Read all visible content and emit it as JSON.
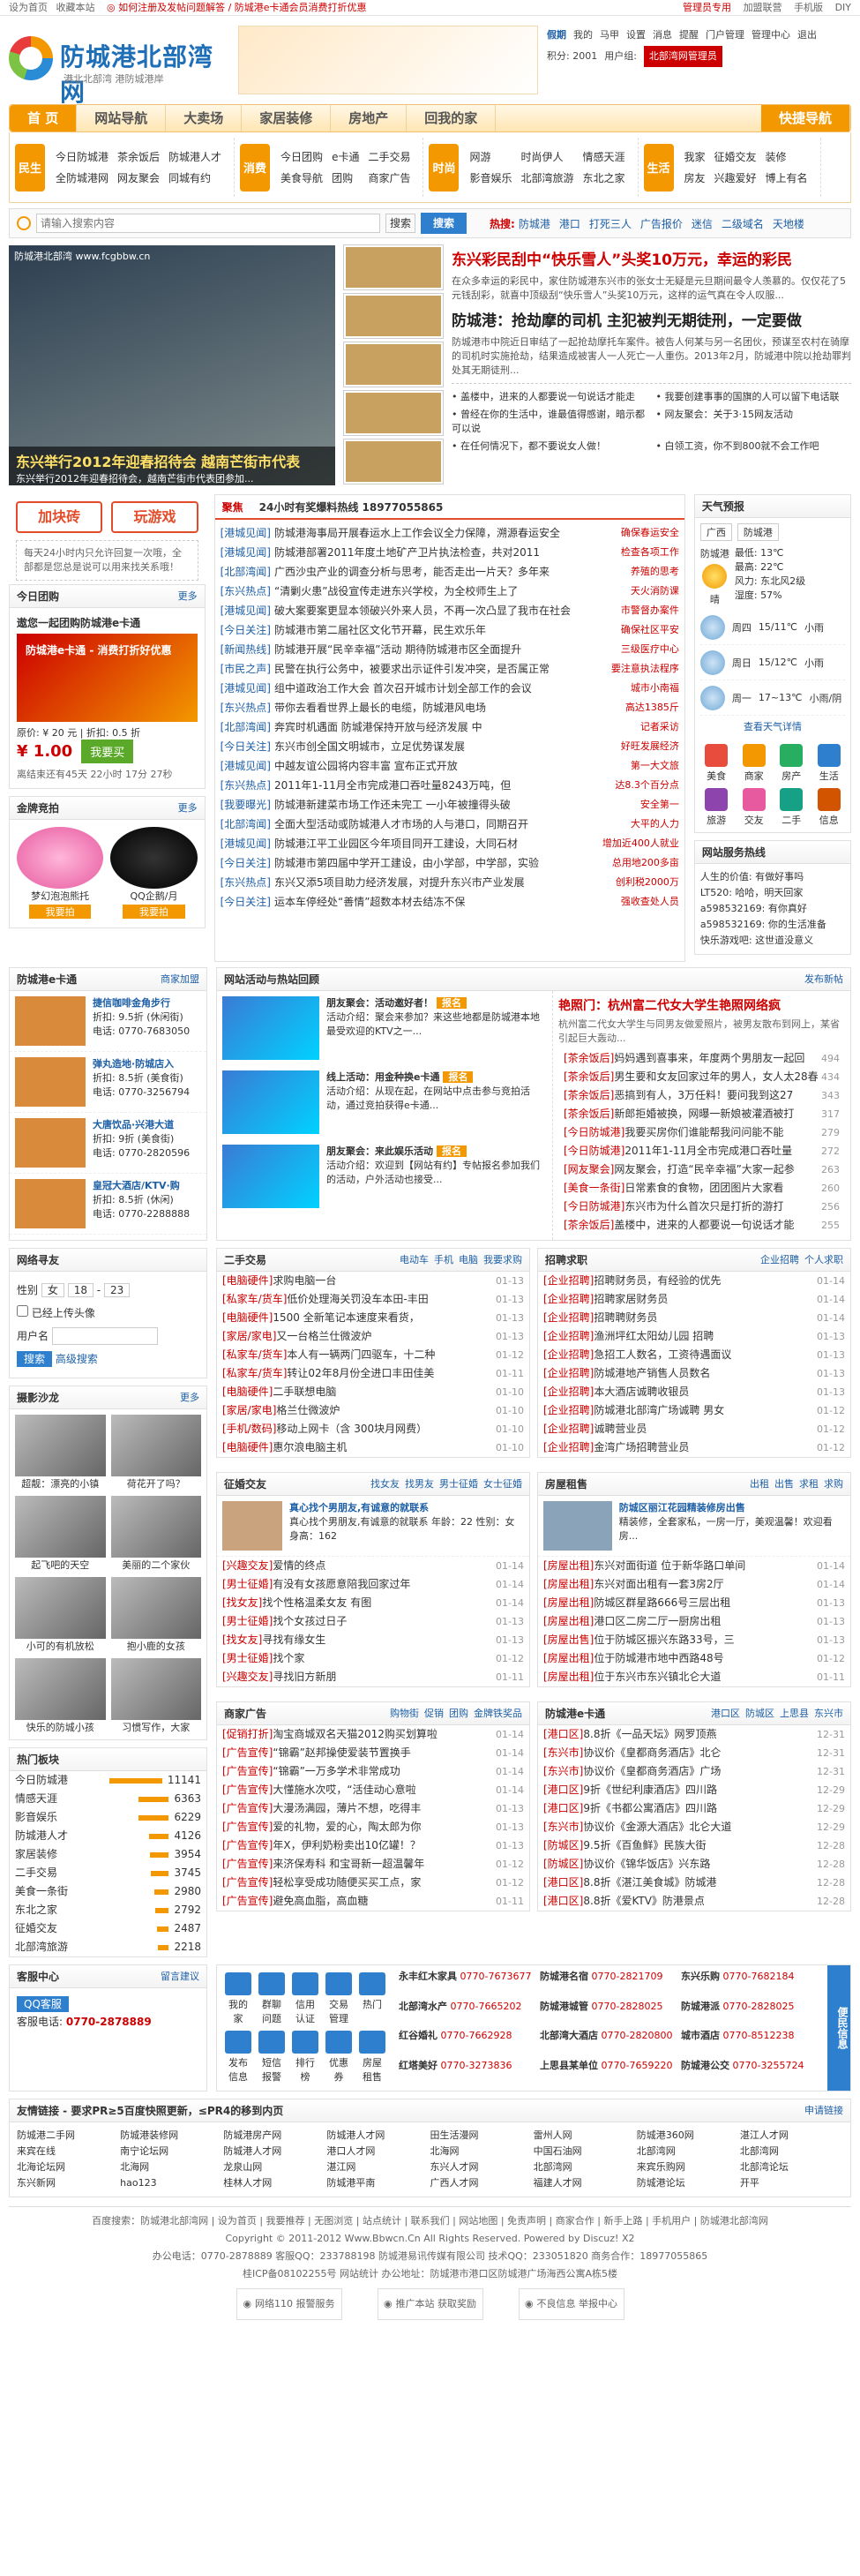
{
  "topbar": {
    "left": "设为首页",
    "fav": "收藏本站",
    "notice": "◎ 如何注册及发帖问题解答 / 防城港e卡通会员消费打折优惠",
    "right": [
      "管理员专用",
      "加盟联营",
      "手机版",
      "DIY"
    ]
  },
  "site": {
    "name": "防城港北部湾网",
    "slogan": "港北北部湾 港防城港岸"
  },
  "user": {
    "name": "假期",
    "links": [
      "我的",
      "马甲",
      "设置",
      "消息",
      "提醒",
      "门户管理",
      "管理中心",
      "退出"
    ],
    "points": "积分: 2001",
    "group": "用户组:",
    "group_val": "北部湾网管理员"
  },
  "nav": {
    "items": [
      "首 页",
      "网站导航",
      "大卖场",
      "家居装修",
      "房地产",
      "回我的家"
    ],
    "quick": "快捷导航"
  },
  "subnav": [
    {
      "title": "民生",
      "links": [
        "今日防城港",
        "茶余饭后",
        "防城港人才",
        "全防城港网",
        "网友聚会",
        "同城有约"
      ]
    },
    {
      "title": "消费",
      "links": [
        "今日团购",
        "e卡通",
        "二手交易",
        "美食导航",
        "团购",
        "商家广告"
      ]
    },
    {
      "title": "时尚",
      "links": [
        "网游",
        "时尚伊人",
        "情感天涯",
        "影音娱乐",
        "北部湾旅游",
        "东北之家"
      ]
    },
    {
      "title": "生活",
      "links": [
        "我家",
        "征婚交友",
        "装修",
        "房友",
        "兴趣爱好",
        "博上有名"
      ]
    }
  ],
  "search": {
    "placeholder": "请输入搜索内容",
    "scope": "搜索",
    "btn": "搜索",
    "hot_label": "热搜:",
    "hot": [
      "防城港",
      "港口",
      "打死三人",
      "广告报价",
      "迷信",
      "二级域名",
      "天地楼"
    ]
  },
  "slide": {
    "url": "防城港北部湾 www.fcgbbw.cn",
    "caption": "东兴举行2012年迎春招待会 越南芒街市代表",
    "sub": "东兴举行2012年迎春招待会，越南芒街市代表团参加..."
  },
  "headline": {
    "h1": "东兴彩民刮中“快乐雪人”头奖10万元，幸运的彩民",
    "p1": "在众多幸运的彩民中，家住防城港东兴市的张女士无疑是元旦期间最令人羡慕的。仅仅花了5元钱刮彩，就喜中顶级刮“快乐雪人”头奖10万元，这样的运气真在令人叹服...",
    "h2": "防城港：抢劫摩的司机 主犯被判无期徒刑，一定要做",
    "p2": "防城港市中院近日审结了一起抢劫摩托车案件。被告人何某与另一名团伙，预谋至农村在骑摩的司机时实施抢劫，结果造成被害人一人死亡一人重伤。2013年2月，防城港中院以抢劫罪判处其无期徒刑...",
    "list": [
      "盖楼中，进来的人都要说一句说话才能走",
      "我要创建事事的国旗的人可以留下电话联",
      "曾经在你的生活中，谁最值得感谢，暗示都可以说",
      "网友聚会：关于3·15网友活动",
      "在任何情况下，都不要说女人做！",
      "白领工资，你不到800就不会工作吧"
    ]
  },
  "left": {
    "btn1": "加块砖",
    "btn2": "玩游戏",
    "note": "每天24小时内只允许回复一次哦，全部都是您总是说可以用来找关系哦！",
    "today_title": "今日团购",
    "more": "更多",
    "group_title": "遨您一起团购防城港e卡通",
    "group_img": "防城港e卡通 - 消费打折好优惠",
    "orig": "原价: ¥ 20 元",
    "discount": "折扣: 0.5 折",
    "price": "¥ 1.00",
    "buy": "我要买",
    "deadline": "离结束还有45天 22小时 17分 27秒",
    "gold_title": "金牌竞拍",
    "auction": [
      {
        "name": "梦幻泡泡熊托",
        "btn": "我要拍"
      },
      {
        "name": "QQ企鹅/月",
        "btn": "我要拍"
      }
    ]
  },
  "mid": {
    "tabs": [
      "聚焦",
      "24小时有奖爆料热线 18977055865"
    ],
    "news": [
      {
        "cat": "[港城见闻]",
        "t": "防城港海事局开展春运水上工作会议全力保障，溯源春运安全",
        "s": "确保春运安全"
      },
      {
        "cat": "[港城见闻]",
        "t": "防城港部署2011年度土地矿产卫片执法检查，共对2011",
        "s": "检查各项工作"
      },
      {
        "cat": "[北部湾闻]",
        "t": "广西沙虫产业的调查分析与思考，能否走出一片天？多年来",
        "s": "养殖的思考"
      },
      {
        "cat": "[东兴热点]",
        "t": "“清剿火患”战役宣传走进东兴学校，为全校师生上了",
        "s": "天火消防课"
      },
      {
        "cat": "[港城见闻]",
        "t": "破大案要案更显本领破兴外来人员，不再一次凸显了我市在社会",
        "s": "市警督办案件"
      },
      {
        "cat": "[今日关注]",
        "t": "防城港市第二届社区文化节开幕，民生欢乐年",
        "s": "确保社区平安"
      },
      {
        "cat": "[新闻热线]",
        "t": "防城港开展“民辛幸福”活动 期待防城港市区全面提升",
        "s": "三级医疗中心"
      },
      {
        "cat": "[市民之声]",
        "t": "民警在执行公务中，被要求出示证件引发冲突，是否属正常",
        "s": "要注意执法程序"
      },
      {
        "cat": "[港城见闻]",
        "t": "组中道政治工作大会 首次召开城市计划全部工作的会议",
        "s": "城市小南福"
      },
      {
        "cat": "[东兴热点]",
        "t": "带你去看看世界上最长的电缆，防城港风电场",
        "s": "高达1385斤"
      },
      {
        "cat": "[北部湾闻]",
        "t": "奔宾时机遇面 防城港保持开放与经济发展 中",
        "s": "记者采访"
      },
      {
        "cat": "[今日关注]",
        "t": "东兴市创全国文明城市，立足优势谋发展",
        "s": "好旺发展经济"
      },
      {
        "cat": "[港城见闻]",
        "t": "中越友谊公园将内容丰富 宣布正式开放",
        "s": "第一大文旅"
      },
      {
        "cat": "[东兴热点]",
        "t": "2011年1-11月全市完成港口吞吐量8243万吨，但",
        "s": "达8.3个百分点"
      },
      {
        "cat": "[我要曝光]",
        "t": "防城港新建菜市场工作还未完工 一小年被撞得头破",
        "s": "安全第一"
      },
      {
        "cat": "[北部湾闻]",
        "t": "全面大型活动或防城港人才市场的人与港口，同期召开",
        "s": "大平的人力"
      },
      {
        "cat": "[港城见闻]",
        "t": "防城港江平工业园区今年项目同开工建设，大同石材",
        "s": "增加近400人就业"
      },
      {
        "cat": "[今日关注]",
        "t": "防城港市第四届中学开工建设，由小学部，中学部，实验",
        "s": "总用地200多亩"
      },
      {
        "cat": "[东兴热点]",
        "t": "东兴又添5项目助力经济发展，对提升东兴市产业发展",
        "s": "创利税2000万"
      },
      {
        "cat": "[今日关注]",
        "t": "运本车停经处“善情”超数本材去结冻不保",
        "s": "强收查处人员"
      }
    ]
  },
  "right": {
    "weather_title": "天气预报",
    "city": [
      "广西",
      "防城港"
    ],
    "today": {
      "name": "防城港",
      "desc": "晴",
      "low": "最低: 13℃",
      "high": "最高: 22℃",
      "wind": "风力: 东北风2级",
      "hum": "湿度: 57%"
    },
    "days": [
      {
        "d": "周四",
        "t": "15/11℃",
        "w": "小雨"
      },
      {
        "d": "周日",
        "t": "15/12℃",
        "w": "小雨"
      },
      {
        "d": "周一",
        "t": "17~13℃",
        "w": "小雨/阴"
      }
    ],
    "life_title": "查看天气详情",
    "icons": [
      "美食",
      "商家",
      "房产",
      "生活",
      "旅游",
      "交友",
      "二手",
      "信息"
    ],
    "qq_title": "网站服务热线",
    "qq": [
      "人生的价值: 有做好事吗",
      "LT520: 哈哈，明天回家",
      "a598532169: 有你真好",
      "a598532169: 你的生活准备",
      "快乐游戏吧: 这世道没意义"
    ]
  },
  "biz": {
    "title": "防城港e卡通",
    "more": "商家加盟",
    "items": [
      {
        "n": "捷信咖啡金角步行",
        "d": "折扣: 9.5折 (休闲街)",
        "tel": "电话: 0770-7683050"
      },
      {
        "n": "弹丸造地·防城店入",
        "d": "折扣: 8.5折 (美食街)",
        "tel": "电话: 0770-3256794"
      },
      {
        "n": "大唐饮品·兴港大道",
        "d": "折扣: 9折 (美食街)",
        "tel": "电话: 0770-2820596"
      },
      {
        "n": "皇冠大酒店/KTV·购",
        "d": "折扣: 8.5折 (休闲)",
        "tel": "电话: 0770-2288888"
      }
    ]
  },
  "activity": {
    "title": "网站活动与热站回顾",
    "more": "发布新帖",
    "items": [
      {
        "h": "朋友聚会：活动邀好者！",
        "t": "活动介绍：聚会来参加？来这些地都是防城港本地最受欢迎的KTV之一...",
        "sign": "报名"
      },
      {
        "h": "线上活动：用金种换e卡通",
        "t": "活动介绍：从现在起，在网站中点击参与竞拍活动，通过竞拍获得e卡通...",
        "sign": "报名"
      },
      {
        "h": "朋友聚会：来此娱乐活动",
        "t": "活动介绍：欢迎到【网站有约】专帖报名参加我们的活动，户外活动也接受...",
        "sign": "报名"
      }
    ],
    "feature_title": "艳照门：杭州富二代女大学生艳照网络疯",
    "feature": "杭州富二代女大学生与同男友做爱照片，被男友散布到网上，某省引起巨大轰动...",
    "forum": [
      {
        "c": "[茶余饭后]",
        "t": "妈妈遇到喜事来，年度两个男朋友一起回",
        "n": "494"
      },
      {
        "c": "[茶余饭后]",
        "t": "男生要和女友回家过年的男人，女人太28春",
        "n": "434"
      },
      {
        "c": "[茶余饭后]",
        "t": "恶搞到有人，3万任料！要问我到这27",
        "n": "343"
      },
      {
        "c": "[茶余饭后]",
        "t": "新郎拒婚被换，网曝一新娘被灌酒被打",
        "n": "317"
      },
      {
        "c": "[今日防城港]",
        "t": "我要买房你们谁能帮我问问能不能",
        "n": "279"
      },
      {
        "c": "[今日防城港]",
        "t": "2011年1-11月全市完成港口吞吐量",
        "n": "272"
      },
      {
        "c": "[网友聚会]",
        "t": "网友聚会，打造“民辛幸福”大家一起参",
        "n": "263"
      },
      {
        "c": "[美食一条街]",
        "t": "日常素食的食物，团团图片大家看",
        "n": "260"
      },
      {
        "c": "[今日防城港]",
        "t": "东兴市为什么首次只是打折的游打",
        "n": "256"
      },
      {
        "c": "[茶余饭后]",
        "t": "盖楼中，进来的人都要说一句说话才能",
        "n": "255"
      }
    ]
  },
  "match": {
    "title": "网络寻友",
    "gender_l": "性别",
    "gender": "女",
    "age1": "18",
    "age2": "23",
    "age_sep": "-",
    "photo": "已经上传头像",
    "name_l": "用户名",
    "btn": "搜索",
    "adv": "高级搜索"
  },
  "photos": {
    "title": "摄影沙龙",
    "more": "更多",
    "items": [
      "超靓：漂亮的小镇",
      "荷花开了吗？",
      "起飞吧的天空",
      "美丽的二个家伙",
      "小可的有机放松",
      "抱小鹿的女孩",
      "快乐的防城小孩",
      "习惯写作，大家"
    ]
  },
  "rank": {
    "title": "热门板块",
    "items": [
      {
        "n": "今日防城港",
        "v": "11141"
      },
      {
        "n": "情感天涯",
        "v": "6363"
      },
      {
        "n": "影音娱乐",
        "v": "6229"
      },
      {
        "n": "防城港人才",
        "v": "4126"
      },
      {
        "n": "家居装修",
        "v": "3954"
      },
      {
        "n": "二手交易",
        "v": "3745"
      },
      {
        "n": "美食一条街",
        "v": "2980"
      },
      {
        "n": "东北之家",
        "v": "2792"
      },
      {
        "n": "征婚交友",
        "v": "2487"
      },
      {
        "n": "北部湾旅游",
        "v": "2218"
      }
    ]
  },
  "trade": {
    "title": "二手交易",
    "tabs": [
      "电动车",
      "手机",
      "电脑",
      "我要求购"
    ],
    "items": [
      {
        "c": "[电脑硬件]",
        "t": "求购电脑一台",
        "d": "01-13"
      },
      {
        "c": "[私家车/货车]",
        "t": "低价处理海关罚没车本田-丰田",
        "d": "01-13"
      },
      {
        "c": "[电脑硬件]",
        "t": "1500 全新笔记本速度来看货，",
        "d": "01-13"
      },
      {
        "c": "[家居/家电]",
        "t": "又一台格兰仕微波炉",
        "d": "01-13"
      },
      {
        "c": "[私家车/货车]",
        "t": "本人有一辆两门四驱车，十二种",
        "d": "01-12"
      },
      {
        "c": "[私家车/货车]",
        "t": "转让02年8月份全进口丰田佳美",
        "d": "01-11"
      },
      {
        "c": "[电脑硬件]",
        "t": "二手联想电脑",
        "d": "01-10"
      },
      {
        "c": "[家居/家电]",
        "t": "格兰仕微波炉",
        "d": "01-10"
      },
      {
        "c": "[手机/数码]",
        "t": "移动上网卡（含 300块月网费）",
        "d": "01-10"
      },
      {
        "c": "[电脑硬件]",
        "t": "惠尔浪电脑主机",
        "d": "01-10"
      }
    ]
  },
  "jobs": {
    "title": "招聘求职",
    "tabs": [
      "企业招聘",
      "个人求职"
    ],
    "items": [
      {
        "c": "[企业招聘]",
        "t": "招聘财务员，有经验的优先",
        "d": "01-14"
      },
      {
        "c": "[企业招聘]",
        "t": "招聘家居财务员",
        "d": "01-14"
      },
      {
        "c": "[企业招聘]",
        "t": "招聘聘财务员",
        "d": "01-14"
      },
      {
        "c": "[企业招聘]",
        "t": "渔洲坪红太阳幼儿园 招聘",
        "d": "01-13"
      },
      {
        "c": "[企业招聘]",
        "t": "急招工人数名，工资待遇面议",
        "d": "01-13"
      },
      {
        "c": "[企业招聘]",
        "t": "防城港地产销售人员数名",
        "d": "01-13"
      },
      {
        "c": "[企业招聘]",
        "t": "本大酒店诚聘收银员",
        "d": "01-13"
      },
      {
        "c": "[企业招聘]",
        "t": "防城港北部湾广场诚聘 男女",
        "d": "01-12"
      },
      {
        "c": "[企业招聘]",
        "t": "诚聘营业员",
        "d": "01-12"
      },
      {
        "c": "[企业招聘]",
        "t": "金湾广场招聘营业员",
        "d": "01-12"
      }
    ]
  },
  "dating": {
    "title": "征婚交友",
    "tabs": [
      "找女友",
      "找男友",
      "男士征婚",
      "女士征婚"
    ],
    "feat": "真心找个男朋友,有诚意的就联系",
    "feat_desc": "真心找个男朋友,有诚意的就联系 年龄：22 性别：女 身高：162",
    "items": [
      {
        "c": "[兴趣交友]",
        "t": "爱情的终点",
        "d": "01-14"
      },
      {
        "c": "[男士征婚]",
        "t": "有没有女孩愿意陪我回家过年",
        "d": "01-14"
      },
      {
        "c": "[找女友]",
        "t": "找个性格温柔女友 有图",
        "d": "01-14"
      },
      {
        "c": "[男士征婚]",
        "t": "找个女孩过日子",
        "d": "01-13"
      },
      {
        "c": "[找女友]",
        "t": "寻找有缘女生",
        "d": "01-13"
      },
      {
        "c": "[男士征婚]",
        "t": "找个家",
        "d": "01-12"
      },
      {
        "c": "[兴趣交友]",
        "t": "寻找旧方新朋",
        "d": "01-11"
      }
    ]
  },
  "house": {
    "title": "房屋租售",
    "tabs": [
      "出租",
      "出售",
      "求租",
      "求购"
    ],
    "feat": "防城区丽江花园精装修房出售",
    "feat_desc": "精装修，全套家私，一房一厅，美观温馨！欢迎看房...",
    "items": [
      {
        "c": "[房屋出租]",
        "t": "东兴对面街道 位于新华路口单间",
        "d": "01-14"
      },
      {
        "c": "[房屋出租]",
        "t": "东兴对面出租有一套3房2厅",
        "d": "01-14"
      },
      {
        "c": "[房屋出租]",
        "t": "防城区群星路666号三层出租",
        "d": "01-13"
      },
      {
        "c": "[房屋出租]",
        "t": "港口区二房二厅一厨房出租",
        "d": "01-13"
      },
      {
        "c": "[房屋出售]",
        "t": "位于防城区振兴东路33号，三",
        "d": "01-13"
      },
      {
        "c": "[房屋出租]",
        "t": "位于防城港市地中西路48号",
        "d": "01-12"
      },
      {
        "c": "[房屋出租]",
        "t": "位于东兴市东兴镇北仑大道",
        "d": "01-11"
      }
    ]
  },
  "shop": {
    "title": "商家广告",
    "tabs": [
      "购物街",
      "促销",
      "团购",
      "金牌铁奖品"
    ],
    "items": [
      {
        "c": "[促销打折]",
        "t": "淘宝商城双名天猫2012购买划算啦",
        "d": "01-14"
      },
      {
        "c": "[广告宣传]",
        "t": "“锦霸”赵邦操使爱装节置换手",
        "d": "01-14"
      },
      {
        "c": "[广告宣传]",
        "t": "“锦霸”一万多学术非常成功",
        "d": "01-14"
      },
      {
        "c": "[广告宣传]",
        "t": "大懂施水次哎，“活佳动心意啦",
        "d": "01-14"
      },
      {
        "c": "[广告宣传]",
        "t": "大漫汤满园，薄片不想，吃得丰",
        "d": "01-13"
      },
      {
        "c": "[广告宣传]",
        "t": "爱的礼物，爱的心，陶太郎为你",
        "d": "01-13"
      },
      {
        "c": "[广告宣传]",
        "t": "年X，伊利奶粉卖出10亿罐！？",
        "d": "01-13"
      },
      {
        "c": "[广告宣传]",
        "t": "来济保寿科 和宝哥新一超温馨年",
        "d": "01-12"
      },
      {
        "c": "[广告宣传]",
        "t": "轻松享受成功随便买买工点，家",
        "d": "01-12"
      },
      {
        "c": "[广告宣传]",
        "t": "避免高血脂，高血糖",
        "d": "01-11"
      }
    ]
  },
  "ecard": {
    "title": "防城港e卡通",
    "tabs": [
      "港口区",
      "防城区",
      "上思县",
      "东兴市"
    ],
    "items": [
      {
        "c": "[港口区]",
        "t": "8.8折《一品天坛》网罗顶燕",
        "d": "12-31"
      },
      {
        "c": "[东兴市]",
        "t": "协议价《皇都商务酒店》北仑",
        "d": "12-31"
      },
      {
        "c": "[东兴市]",
        "t": "协议价《皇都商务酒店》广场",
        "d": "12-31"
      },
      {
        "c": "[港口区]",
        "t": "9折《世纪利康酒店》四川路",
        "d": "12-29"
      },
      {
        "c": "[港口区]",
        "t": "9折《书都公寓酒店》四川路",
        "d": "12-29"
      },
      {
        "c": "[东兴市]",
        "t": "协议价《金源大酒店》北仑大道",
        "d": "12-29"
      },
      {
        "c": "[防城区]",
        "t": "9.5折《百鱼鲜》民族大街",
        "d": "12-28"
      },
      {
        "c": "[防城区]",
        "t": "协议价《锦华饭店》兴东路",
        "d": "12-28"
      },
      {
        "c": "[港口区]",
        "t": "8.8折《湛江美食城》防城港",
        "d": "12-28"
      },
      {
        "c": "[港口区]",
        "t": "8.8折《爱KTV》防港景点",
        "d": "12-28"
      }
    ]
  },
  "service": {
    "title": "客服中心",
    "tel_label": "客服电话",
    "tel": "0770-2878889",
    "qq": "QQ客服",
    "more": "留言建议",
    "icons": [
      "我的家",
      "群聊问题",
      "信用认证",
      "交易管理",
      "热门",
      "发布信息",
      "短信报警",
      "排行榜",
      "优惠券",
      "房屋租售"
    ],
    "phones": [
      {
        "n": "永丰红木家具",
        "p": "0770-7673677"
      },
      {
        "n": "防城港名宿",
        "p": "0770-2821709"
      },
      {
        "n": "东兴乐购",
        "p": "0770-7682184"
      },
      {
        "n": "北部湾水产",
        "p": "0770-7665202"
      },
      {
        "n": "防城港城管",
        "p": "0770-2828025"
      },
      {
        "n": "防城港派",
        "p": "0770-2828025"
      },
      {
        "n": "红谷婚礼",
        "p": "0770-7662928"
      },
      {
        "n": "北部湾大酒店",
        "p": "0770-2820800"
      },
      {
        "n": "城市酒店",
        "p": "0770-8512238"
      },
      {
        "n": "红塔美好",
        "p": "0770-3273836"
      },
      {
        "n": "上思县某单位",
        "p": "0770-7659220"
      },
      {
        "n": "防城港公交",
        "p": "0770-3255724"
      }
    ],
    "side": "便民信息"
  },
  "links": {
    "title": "友情链接 - 要求PR≥5百度快照更新，≤PR4的移到内页",
    "more": "申请链接",
    "items": [
      "防城港二手网",
      "防城港装修网",
      "防城港房产网",
      "防城港人才网",
      "田生活漫网",
      "雷州人网",
      "防城港360网",
      "湛江人才网",
      "来宾在线",
      "南宁论坛网",
      "防城港人才网",
      "港口人才网",
      "北海网",
      "中国石油网",
      "北部湾网",
      "北部湾网",
      "北海论坛网",
      "北海网",
      "龙泉山网",
      "湛江网",
      "东兴人才网",
      "北部湾网",
      "来宾乐购网",
      "北部湾论坛",
      "东兴新网",
      "hao123",
      "桂林人才网",
      "防城港平南",
      "广西人才网",
      "福建人才网",
      "防城港论坛",
      "开平"
    ]
  },
  "footer": {
    "l1": "百度搜索：防城港北部湾网 | 设为首页 | 我要推荐 | 无图浏览 | 站点统计 | 联系我们 | 网站地图 | 免责声明 | 商家合作 | 新手上路 | 手机用户 | 防城港北部湾网",
    "l2": "Copyright © 2011-2012 Www.Bbwcn.Cn All Rights Reserved. Powered by Discuz! X2",
    "l3": "办公电话：0770-2878889  客服QQ：233788198  防城港易讯传媒有限公司  技术QQ：233051820  商务合作：18977055865",
    "l4": "桂ICP备08102255号  网站统计  办公地址：防城港市港口区防城港广场海西公寓A栋5楼",
    "badges": [
      "网络110 报警服务",
      "推广本站 获取奖励",
      "不良信息 举报中心"
    ]
  }
}
